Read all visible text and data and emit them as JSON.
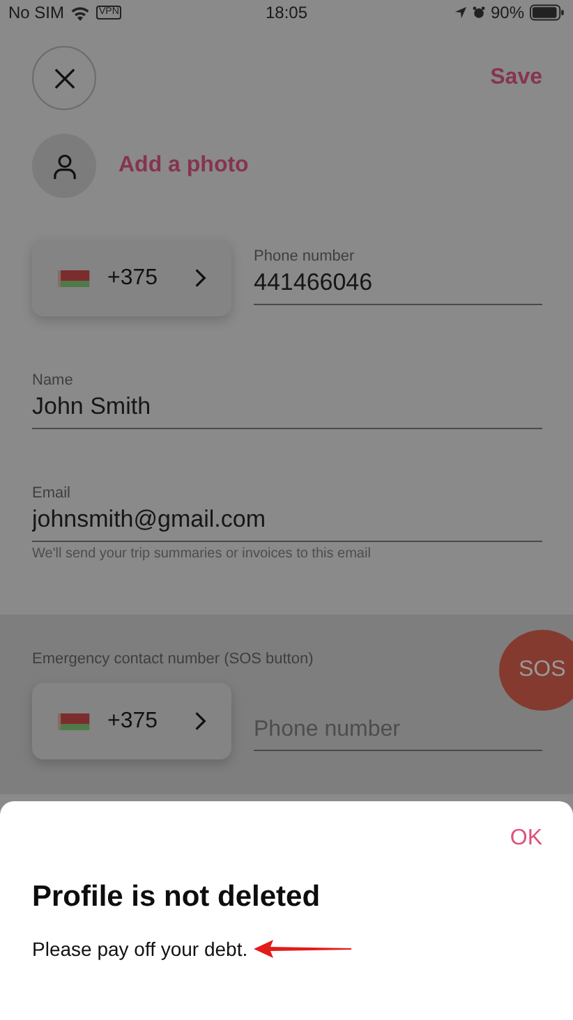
{
  "status_bar": {
    "carrier": "No SIM",
    "vpn": "VPN",
    "time": "18:05",
    "battery": "90%"
  },
  "header": {
    "save": "Save"
  },
  "photo": {
    "label": "Add a photo"
  },
  "phone": {
    "code": "+375",
    "label": "Phone number",
    "value": "441466046"
  },
  "fields": [
    {
      "label": "Name",
      "value": "John Smith"
    },
    {
      "label": "Email",
      "value": "johnsmith@gmail.com",
      "hint": "We'll send your trip summaries or invoices to this email"
    }
  ],
  "emergency": {
    "label": "Emergency contact number (SOS button)",
    "code": "+375",
    "placeholder": "Phone number"
  },
  "sos": "SOS",
  "dialog": {
    "action": "OK",
    "title": "Profile is not deleted",
    "message": "Please pay off your debt."
  }
}
